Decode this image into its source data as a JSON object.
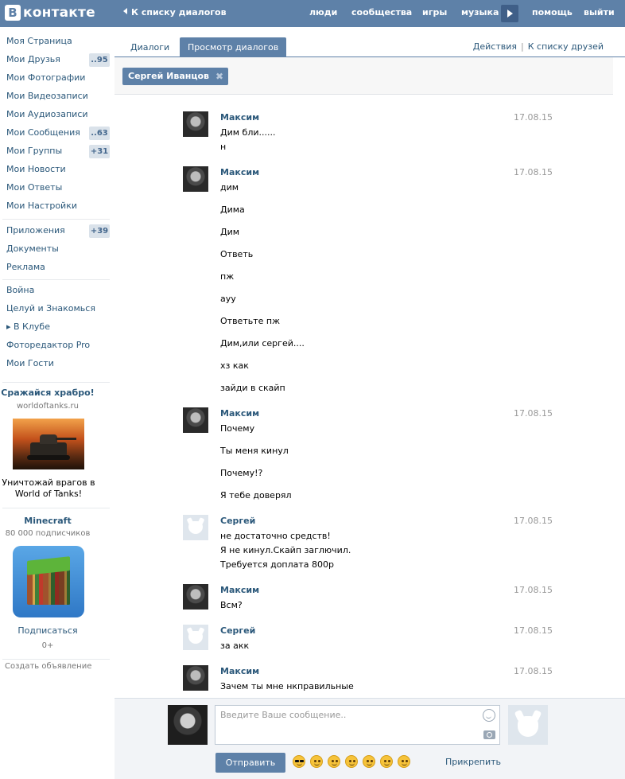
{
  "header": {
    "logo_letter": "В",
    "logo_text": "контакте",
    "back_link": "К списку диалогов",
    "nav": {
      "people": "люди",
      "communities": "сообщества",
      "games": "игры",
      "music": "музыка",
      "help": "помощь",
      "exit": "выйти"
    },
    "brand_color": "#5e81a8"
  },
  "sidebar": {
    "items": [
      {
        "label": "Моя Страница"
      },
      {
        "label": "Мои Друзья",
        "badge": "..95"
      },
      {
        "label": "Мои Фотографии"
      },
      {
        "label": "Мои Видеозаписи"
      },
      {
        "label": "Мои Аудиозаписи"
      },
      {
        "label": "Мои Сообщения",
        "badge": "..63"
      },
      {
        "label": "Мои Группы",
        "badge": "+31"
      },
      {
        "label": "Мои Новости"
      },
      {
        "label": "Мои Ответы"
      },
      {
        "label": "Мои Настройки"
      }
    ],
    "items2": [
      {
        "label": "Приложения",
        "badge": "+39"
      },
      {
        "label": "Документы"
      },
      {
        "label": "Реклама"
      }
    ],
    "items3": [
      {
        "label": "Война"
      },
      {
        "label": "Целуй и Знакомься"
      },
      {
        "label": "▸ В Клубе"
      },
      {
        "label": "Фоторедактор Pro"
      },
      {
        "label": "Мои Гости"
      }
    ],
    "ads": {
      "tanks_title": "Сражайся храбро!",
      "tanks_domain": "worldoftanks.ru",
      "tanks_text_1": "Уничтожай врагов в",
      "tanks_text_2": "World of Tanks!",
      "mc_title": "Minecraft",
      "mc_subscribers": "80 000 подписчиков",
      "mc_subscribe": "Подписаться",
      "mc_age": "0+",
      "create_ad": "Создать объявление"
    }
  },
  "tabs": {
    "dialogs": "Диалоги",
    "view": "Просмотр диалогов",
    "actions": "Действия",
    "separator": "|",
    "friends_list": "К списку друзей"
  },
  "filter": {
    "chip": "Сергей Иванцов",
    "chip_close": "✖"
  },
  "messages": [
    {
      "author": "Максим",
      "date": "17.08.15",
      "avatar": "maxim",
      "lines": [
        "Дим бли......",
        "н"
      ]
    },
    {
      "author": "Максим",
      "date": "17.08.15",
      "avatar": "maxim",
      "lines": [
        "дим",
        "Дима",
        "Дим",
        "Ответь",
        "пж",
        "ауу",
        "Ответьте пж",
        "Дим,или сергей....",
        "хз как",
        "зайди в скайп"
      ]
    },
    {
      "author": "Максим",
      "date": "17.08.15",
      "avatar": "maxim",
      "lines": [
        "Почему",
        "Ты меня кинул",
        "Почему!?",
        "Я тебе доверял"
      ]
    },
    {
      "author": "Сергей",
      "date": "17.08.15",
      "avatar": "sergey",
      "lines": [
        "не достаточно средств!",
        "Я не кинул.Скайп заглючил.",
        "Требуется доплата 800р"
      ]
    },
    {
      "author": "Максим",
      "date": "17.08.15",
      "avatar": "maxim",
      "lines": [
        "Всм?"
      ]
    },
    {
      "author": "Сергей",
      "date": "17.08.15",
      "avatar": "sergey",
      "lines": [
        "за акк"
      ]
    },
    {
      "author": "Максим",
      "date": "17.08.15",
      "avatar": "maxim",
      "lines": [
        "Зачем ты мне нкправильные"
      ]
    }
  ],
  "compose": {
    "placeholder": "Введите Ваше сообщение..",
    "send": "Отправить",
    "attach": "Прикрепить"
  }
}
